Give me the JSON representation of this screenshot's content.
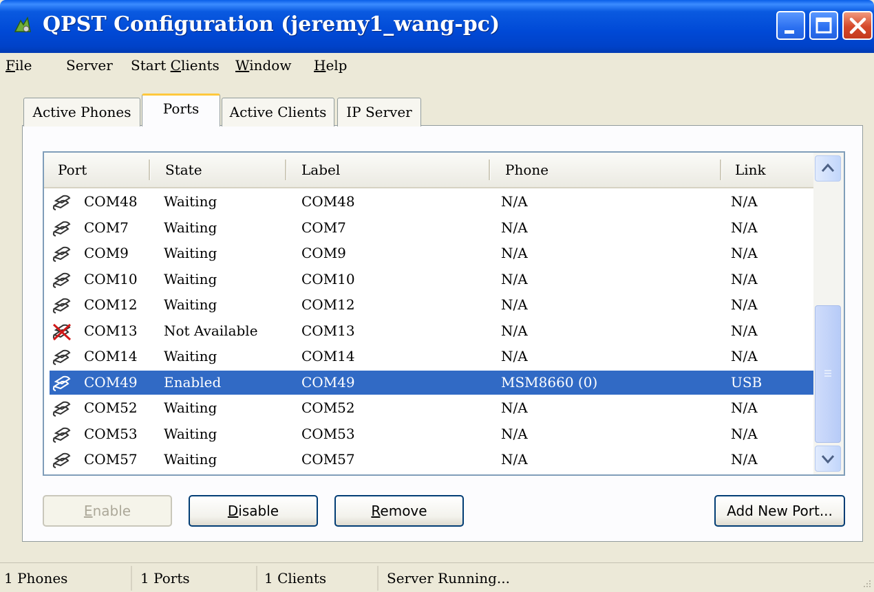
{
  "window": {
    "title": "QPST Configuration (jeremy1_wang-pc)"
  },
  "menu": [
    {
      "label": "File",
      "underline": "F",
      "rest": "ile"
    },
    {
      "label": "Server",
      "underline": "",
      "rest": "Server"
    },
    {
      "label": "Start Clients",
      "pre": "Start ",
      "underline": "C",
      "rest": "lients"
    },
    {
      "label": "Window",
      "underline": "W",
      "rest": "indow"
    },
    {
      "label": "Help",
      "underline": "H",
      "rest": "elp"
    }
  ],
  "tabs": [
    "Active Phones",
    "Ports",
    "Active Clients",
    "IP Server"
  ],
  "active_tab": "Ports",
  "ports_table": {
    "columns": [
      "Port",
      "State",
      "Label",
      "Phone",
      "Link"
    ],
    "rows": [
      {
        "port": "COM48",
        "state": "Waiting",
        "label": "COM48",
        "phone": "N/A",
        "link": "N/A",
        "icon": "serial-port-icon"
      },
      {
        "port": "COM7",
        "state": "Waiting",
        "label": "COM7",
        "phone": "N/A",
        "link": "N/A",
        "icon": "serial-port-icon"
      },
      {
        "port": "COM9",
        "state": "Waiting",
        "label": "COM9",
        "phone": "N/A",
        "link": "N/A",
        "icon": "serial-port-icon"
      },
      {
        "port": "COM10",
        "state": "Waiting",
        "label": "COM10",
        "phone": "N/A",
        "link": "N/A",
        "icon": "serial-port-icon"
      },
      {
        "port": "COM12",
        "state": "Waiting",
        "label": "COM12",
        "phone": "N/A",
        "link": "N/A",
        "icon": "serial-port-icon"
      },
      {
        "port": "COM13",
        "state": "Not Available",
        "label": "COM13",
        "phone": "N/A",
        "link": "N/A",
        "icon": "serial-port-unavailable-icon"
      },
      {
        "port": "COM14",
        "state": "Waiting",
        "label": "COM14",
        "phone": "N/A",
        "link": "N/A",
        "icon": "serial-port-icon"
      },
      {
        "port": "COM49",
        "state": "Enabled",
        "label": "COM49",
        "phone": "MSM8660 (0)",
        "link": "USB",
        "icon": "serial-port-icon",
        "selected": true
      },
      {
        "port": "COM52",
        "state": "Waiting",
        "label": "COM52",
        "phone": "N/A",
        "link": "N/A",
        "icon": "serial-port-icon"
      },
      {
        "port": "COM53",
        "state": "Waiting",
        "label": "COM53",
        "phone": "N/A",
        "link": "N/A",
        "icon": "serial-port-icon"
      },
      {
        "port": "COM57",
        "state": "Waiting",
        "label": "COM57",
        "phone": "N/A",
        "link": "N/A",
        "icon": "serial-port-icon"
      }
    ]
  },
  "buttons": {
    "enable": {
      "underline": "E",
      "rest": "nable",
      "disabled": true
    },
    "disable": {
      "underline": "D",
      "rest": "isable",
      "disabled": false
    },
    "remove": {
      "underline": "R",
      "rest": "emove",
      "disabled": false
    },
    "add_new_port": {
      "label": "Add New Port...",
      "disabled": false
    }
  },
  "status": {
    "phones": "1 Phones",
    "ports": "1 Ports",
    "clients": "1 Clients",
    "server": "Server Running..."
  },
  "colors": {
    "selection": "#316ac5",
    "titlebar": "#0a5ae0"
  }
}
